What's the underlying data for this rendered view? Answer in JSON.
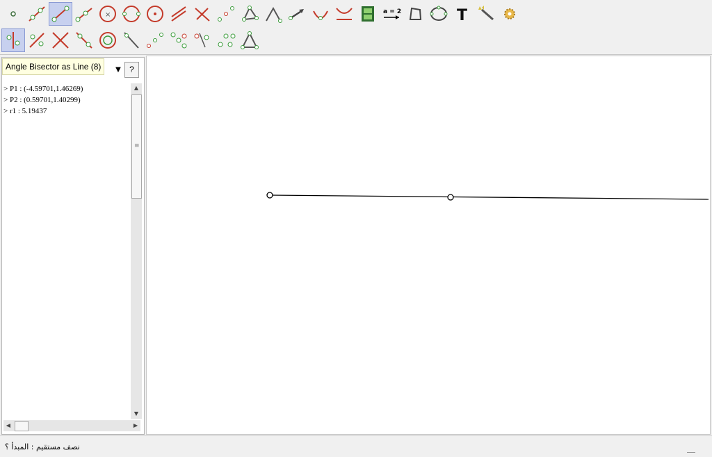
{
  "toolbar": {
    "row1": [
      {
        "name": "point-tool",
        "selected": false
      },
      {
        "name": "line-through-two-points-tool",
        "selected": false
      },
      {
        "name": "segment-between-two-points-tool",
        "selected": true
      },
      {
        "name": "ray-through-two-points-tool",
        "selected": false
      },
      {
        "name": "circle-center-point-tool",
        "selected": false
      },
      {
        "name": "circle-three-points-tool",
        "selected": false
      },
      {
        "name": "circle-center-radius-tool",
        "selected": false
      },
      {
        "name": "parallel-line-tool",
        "selected": false
      },
      {
        "name": "perpendicular-line-tool",
        "selected": false
      },
      {
        "name": "midpoint-tool",
        "selected": false
      },
      {
        "name": "polygon-tool",
        "selected": false
      },
      {
        "name": "angle-tool",
        "selected": false
      },
      {
        "name": "vector-tool",
        "selected": false
      },
      {
        "name": "semicircle-tool",
        "selected": false
      },
      {
        "name": "locus-tool",
        "selected": false
      },
      {
        "name": "film-strip-tool",
        "selected": false
      },
      {
        "name": "slider-tool",
        "selected": false,
        "label": "a = 2"
      },
      {
        "name": "quadrilateral-tool",
        "selected": false
      },
      {
        "name": "conic-tool",
        "selected": false
      },
      {
        "name": "text-tool",
        "selected": false,
        "label": "T"
      },
      {
        "name": "magic-wand-tool",
        "selected": false
      },
      {
        "name": "settings-gear-tool",
        "selected": false
      }
    ],
    "row2": [
      {
        "name": "angle-bisector-tool",
        "selected": true
      },
      {
        "name": "point-on-object-tool",
        "selected": false
      },
      {
        "name": "intersect-tool",
        "selected": false
      },
      {
        "name": "perpendicular-bisector-tool",
        "selected": false
      },
      {
        "name": "circle-tool",
        "selected": false
      },
      {
        "name": "line-tool",
        "selected": false
      },
      {
        "name": "sequence-points-tool",
        "selected": false
      },
      {
        "name": "relation-tool",
        "selected": false
      },
      {
        "name": "reflect-tool",
        "selected": false
      },
      {
        "name": "dilate-tool",
        "selected": false
      },
      {
        "name": "triangle-tool",
        "selected": false
      }
    ]
  },
  "tooltip": "Angle Bisector as Line (8)",
  "help_button": "?",
  "algebra": {
    "rows": [
      "> P1 : (-4.59701,1.46269)",
      "> P2 : (0.59701,1.40299)",
      "> r1 : 5.19437"
    ]
  },
  "status": "نصف مستقيم : المبدأ ؟",
  "colors": {
    "selected_tool_bg": "#c7d0ef",
    "point_fill": "#ffffff",
    "line": "#000000",
    "tool_green": "#3a9b3a",
    "tool_red": "#c43b2b"
  }
}
